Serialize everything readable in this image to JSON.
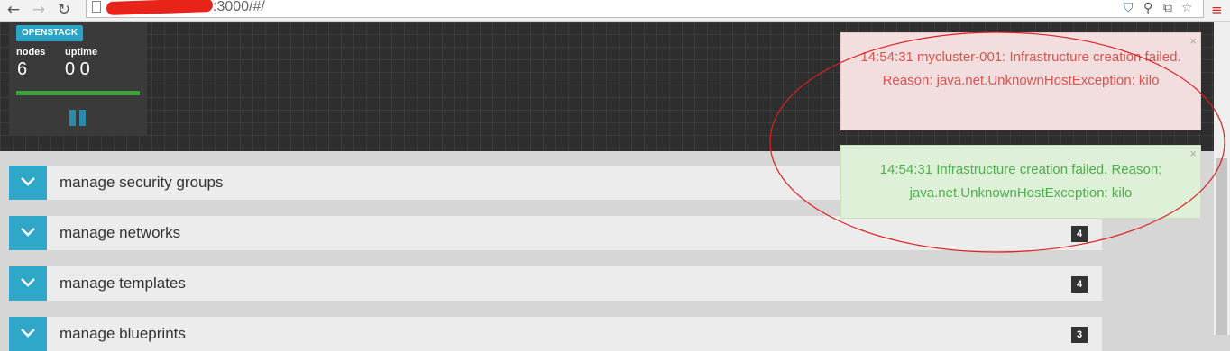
{
  "browser": {
    "url": ":3000/#/"
  },
  "widget": {
    "tag": "OPENSTACK",
    "nodes_label": "nodes",
    "nodes_value": "6",
    "uptime_label": "uptime",
    "uptime_value": "0 0"
  },
  "panels": [
    {
      "title": "manage security groups",
      "badge": ""
    },
    {
      "title": "manage networks",
      "badge": "4"
    },
    {
      "title": "manage templates",
      "badge": "4"
    },
    {
      "title": "manage blueprints",
      "badge": "3"
    }
  ],
  "notifications": [
    {
      "type": "error",
      "text": "14:54:31 mycluster-001: Infrastructure creation failed. Reason: java.net.UnknownHostException: kilo",
      "close": "×"
    },
    {
      "type": "success",
      "text": "14:54:31 Infrastructure creation failed. Reason: java.net.UnknownHostException: kilo",
      "close": "×"
    }
  ],
  "colors": {
    "accent": "#2ea7c9",
    "error_text": "#d9534f",
    "success_text": "#4cae4c",
    "annotation": "#e02020"
  }
}
